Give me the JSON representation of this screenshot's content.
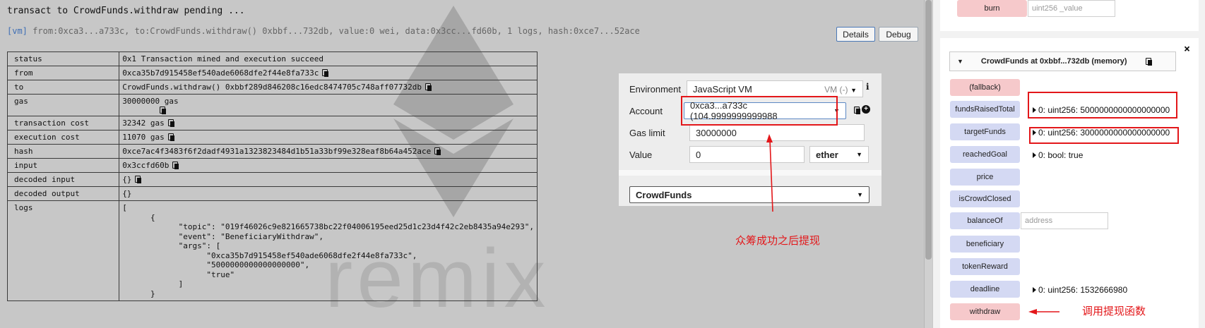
{
  "terminal": {
    "title": "transact to CrowdFunds.withdraw pending ...",
    "summary_tag": "[vm]",
    "summary": "from:0xca3...a733c, to:CrowdFunds.withdraw() 0xbbf...732db, value:0 wei, data:0x3cc...fd60b, 1 logs, hash:0xce7...52ace",
    "details_label": "Details",
    "debug_label": "Debug",
    "watermark": "remix",
    "rows": [
      {
        "key": "status",
        "value": "0x1 Transaction mined and execution succeed"
      },
      {
        "key": "from",
        "value": "0xca35b7d915458ef540ade6068dfe2f44e8fa733c"
      },
      {
        "key": "to",
        "value": "CrowdFunds.withdraw() 0xbbf289d846208c16edc8474705c748aff07732db"
      },
      {
        "key": "gas",
        "value": "30000000 gas"
      },
      {
        "key": "transaction cost",
        "value": "32342 gas"
      },
      {
        "key": "execution cost",
        "value": "11070 gas"
      },
      {
        "key": "hash",
        "value": "0xce7ac4f3483f6f2dadf4931a1323823484d1b51a33bf99e328eaf8b64a452ace"
      },
      {
        "key": "input",
        "value": "0x3ccfd60b"
      },
      {
        "key": "decoded input",
        "value": "{}"
      },
      {
        "key": "decoded output",
        "value": "{}"
      },
      {
        "key": "logs",
        "value": "[\n\t{\n\t\t\"topic\": \"019f46026c9e821665738bc22f04006195eed25d1c23d4f42c2eb8435a94e293\",\n\t\t\"event\": \"BeneficiaryWithdraw\",\n\t\t\"args\": [\n\t\t\t\"0xca35b7d915458ef540ade6068dfe2f44e8fa733c\",\n\t\t\t\"5000000000000000000\",\n\t\t\t\"true\"\n\t\t]\n\t}"
      }
    ]
  },
  "run_panel": {
    "environment_label": "Environment",
    "environment_value": "JavaScript VM",
    "environment_suffix": "VM (-)",
    "account_label": "Account",
    "account_value": "0xca3...a733c (104.9999999999988",
    "gas_limit_label": "Gas limit",
    "gas_limit_value": "30000000",
    "value_label": "Value",
    "value_value": "0",
    "value_unit": "ether",
    "contract_value": "CrowdFunds"
  },
  "deployed": {
    "burn_label": "burn",
    "burn_placeholder": "uint256 _value",
    "instance_title": "CrowdFunds at 0xbbf...732db (memory)",
    "functions": [
      {
        "label": "(fallback)",
        "kind": "tx"
      },
      {
        "label": "fundsRaisedTotal",
        "kind": "call",
        "output": "0: uint256: 5000000000000000000"
      },
      {
        "label": "targetFunds",
        "kind": "call",
        "output": "0: uint256: 3000000000000000000"
      },
      {
        "label": "reachedGoal",
        "kind": "call",
        "output": "0: bool: true"
      },
      {
        "label": "price",
        "kind": "call"
      },
      {
        "label": "isCrowdClosed",
        "kind": "call"
      },
      {
        "label": "balanceOf",
        "kind": "call",
        "placeholder": "address"
      },
      {
        "label": "beneficiary",
        "kind": "call"
      },
      {
        "label": "tokenReward",
        "kind": "call"
      },
      {
        "label": "deadline",
        "kind": "call",
        "output": "0: uint256: 1532666980"
      },
      {
        "label": "withdraw",
        "kind": "tx"
      }
    ]
  },
  "annotations": {
    "withdraw_after_success": "众筹成功之后提现",
    "call_withdraw": "调用提现函数"
  },
  "colors": {
    "annotation_red": "#e3171a",
    "call_button": "#d4d9f3",
    "transact_button": "#f6c9cb"
  }
}
